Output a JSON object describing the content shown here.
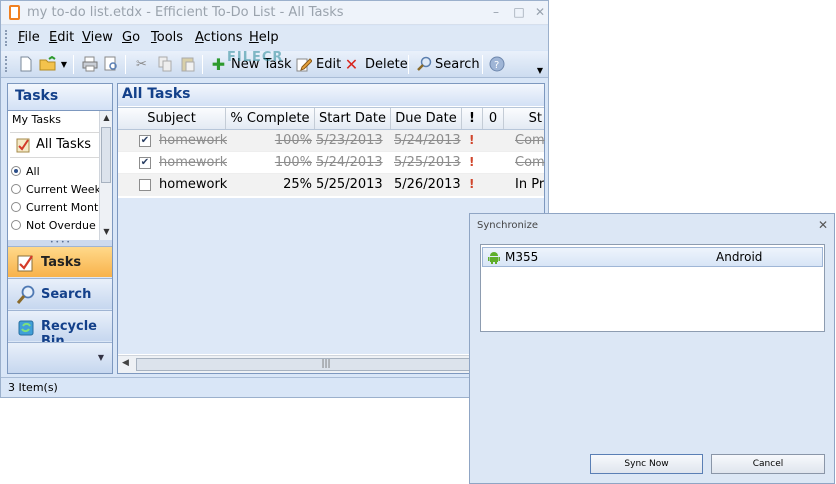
{
  "window": {
    "title": "my to-do list.etdx - Efficient To-Do List - All Tasks",
    "minimize": "–",
    "maximize": "□",
    "close": "✕"
  },
  "menu": [
    "File",
    "Edit",
    "View",
    "Go",
    "Tools",
    "Actions",
    "Help"
  ],
  "toolbar": {
    "new_task": "New Task",
    "edit": "Edit",
    "delete": "Delete",
    "search": "Search",
    "watermark": "FILECR"
  },
  "sidebar": {
    "header": "Tasks",
    "my_tasks": "My Tasks",
    "all_tasks": "All Tasks",
    "filters": [
      {
        "label": "All",
        "selected": true
      },
      {
        "label": "Current Week",
        "selected": false
      },
      {
        "label": "Current Month",
        "selected": false
      },
      {
        "label": "Not Overdue",
        "selected": false
      }
    ],
    "nav": [
      {
        "label": "Tasks",
        "active": true
      },
      {
        "label": "Search",
        "active": false
      },
      {
        "label": "Recycle Bin",
        "active": false
      }
    ]
  },
  "content": {
    "header": "All Tasks",
    "columns": [
      "Subject",
      "% Complete",
      "Start Date",
      "Due Date",
      "!",
      "0",
      "St"
    ],
    "rows": [
      {
        "checked": true,
        "subject": "homework",
        "complete": "100%",
        "start": "5/23/2013",
        "due": "5/24/2013",
        "status": "Com",
        "done": true
      },
      {
        "checked": true,
        "subject": "homework",
        "complete": "100%",
        "start": "5/24/2013",
        "due": "5/25/2013",
        "status": "Com",
        "done": true
      },
      {
        "checked": false,
        "subject": "homework",
        "complete": "25%",
        "start": "5/25/2013",
        "due": "5/26/2013",
        "status": "In Pr",
        "done": false
      }
    ]
  },
  "status": "3 Item(s)",
  "dialog": {
    "title": "Synchronize",
    "close": "✕",
    "device": {
      "name": "M355",
      "type": "Android"
    },
    "sync_button": "Sync Now",
    "cancel_button": "Cancel"
  },
  "colors": {
    "accent": "#13408a",
    "flag": "#d0462c",
    "active_nav": "#f8b24b"
  }
}
